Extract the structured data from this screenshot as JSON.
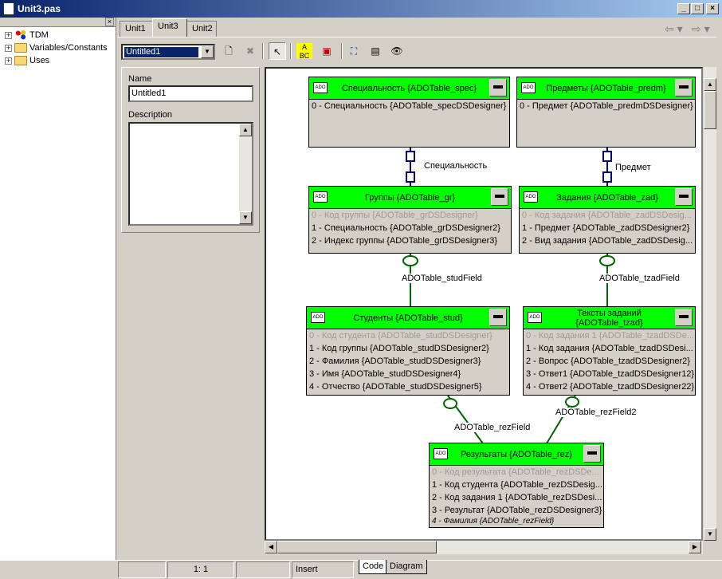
{
  "window": {
    "title": "Unit3.pas"
  },
  "tree": {
    "items": [
      {
        "label": "TDM",
        "icon": "component-icon"
      },
      {
        "label": "Variables/Constants",
        "icon": "folder-icon"
      },
      {
        "label": "Uses",
        "icon": "folder-icon"
      }
    ]
  },
  "tabs": [
    {
      "label": "Unit1"
    },
    {
      "label": "Unit3"
    },
    {
      "label": "Unit2"
    }
  ],
  "toolbar": {
    "diagram_select": "Untitled1"
  },
  "props": {
    "name_label": "Name",
    "name_value": "Untitled1",
    "description_label": "Description"
  },
  "entities": {
    "spec": {
      "title": "Специальность {ADOTable_spec}",
      "rows": [
        "0 - Специальность {ADOTable_specDSDesigner}"
      ]
    },
    "predm": {
      "title": "Предметы {ADOTable_predm}",
      "rows": [
        "0 - Предмет {ADOTable_predmDSDesigner}"
      ]
    },
    "gr": {
      "title": "Группы {ADOTable_gr}",
      "rows": [
        "0 - Код группы {ADOTable_grDSDesigner}",
        "1 - Специальность {ADOTable_grDSDesigner2}",
        "2 - Индекс группы {ADOTable_grDSDesigner3}"
      ]
    },
    "zad": {
      "title": "Задания {ADOTable_zad}",
      "rows": [
        "0 - Код задания {ADOTable_zadDSDesig...",
        "1 - Предмет {ADOTable_zadDSDesigner2}",
        "2 - Вид задания {ADOTable_zadDSDesig..."
      ]
    },
    "stud": {
      "title": "Студенты {ADOTable_stud}",
      "rows": [
        "0 - Код студента {ADOTable_studDSDesigner}",
        "1 - Код группы {ADOTable_studDSDesigner2}",
        "2 - Фамилия {ADOTable_studDSDesigner3}",
        "3 - Имя {ADOTable_studDSDesigner4}",
        "4 - Отчество {ADOTable_studDSDesigner5}"
      ]
    },
    "tzad": {
      "title": "Тексты заданий {ADOTable_tzad}",
      "rows": [
        "0 - Код задания 1 {ADOTable_tzadDSDe...",
        "1 - Код задания {ADOTable_tzadDSDesi...",
        "2 - Вопрос {ADOTable_tzadDSDesigner2}",
        "3 - Ответ1 {ADOTable_tzadDSDesigner12}",
        "4 - Ответ2 {ADOTable_tzadDSDesigner22}"
      ]
    },
    "rez": {
      "title": "Результаты {ADOTable_rez}",
      "rows": [
        "0 - Код результата {ADOTable_rezDSDe...",
        "1 - Код студента {ADOTable_rezDSDesig...",
        "2 - Код задания 1 {ADOTable_rezDSDesi...",
        "3 - Результат {ADOTable_rezDSDesigner3}",
        "4 - Фамилия {ADOTable_rezField}"
      ]
    }
  },
  "relations": {
    "spec_gr": "Специальность",
    "predm_zad": "Предмет",
    "gr_stud": "ADOTable_studField",
    "zad_tzad": "ADOTable_tzadField",
    "stud_rez": "ADOTable_rezField",
    "tzad_rez": "ADOTable_rezField2"
  },
  "status": {
    "position": "1:   1",
    "mode": "Insert",
    "tab_code": "Code",
    "tab_diagram": "Diagram"
  },
  "colors": {
    "entity_header": "#00ff00",
    "title_bar": "#0a246a",
    "link_blue": "#000080",
    "link_green": "#006400"
  }
}
